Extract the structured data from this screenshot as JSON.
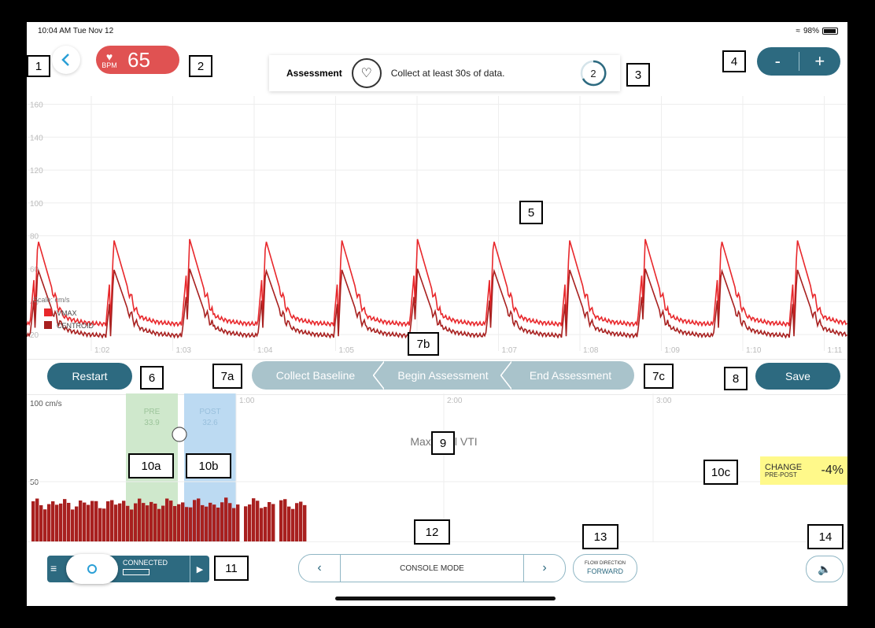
{
  "status": {
    "time": "10:04 AM  Tue Nov 12",
    "battery": "98%"
  },
  "header": {
    "heart_rate": {
      "unit": "BPM",
      "value": "65"
    },
    "assessment": {
      "title": "Assessment",
      "message": "Collect at least 30s of data.",
      "countdown": "2"
    },
    "zoom": {
      "minus": "-",
      "plus": "+"
    }
  },
  "callouts": {
    "c1": "1",
    "c2": "2",
    "c3": "3",
    "c4": "4",
    "c5": "5",
    "c6": "6",
    "c7a": "7a",
    "c7b": "7b",
    "c7c": "7c",
    "c8": "8",
    "c9": "9",
    "c10a": "10a",
    "c10b": "10b",
    "c10c": "10c",
    "c11": "11",
    "c12": "12",
    "c13": "13",
    "c14": "14"
  },
  "workflow": {
    "restart": "Restart",
    "steps": [
      "Collect Baseline",
      "Begin Assessment",
      "End Assessment"
    ],
    "save": "Save"
  },
  "vti": {
    "title": "Max Total VTI",
    "pre": {
      "label": "PRE",
      "value": "33.9"
    },
    "post": {
      "label": "POST",
      "value": "32.6"
    },
    "change_label": "CHANGE",
    "change_sub": "PRE-POST",
    "change_value": "-4%"
  },
  "toolbar": {
    "connection": "CONNECTED",
    "console_mode": "CONSOLE MODE",
    "flow_title": "FLOW DIRECTION",
    "flow_value": "FORWARD"
  },
  "colors": {
    "accent": "#2d6a80",
    "vmax": "#e8272b",
    "centroid": "#a8201f",
    "hr": "#e05252",
    "change_bg": "#fff98a"
  },
  "chart_data": [
    {
      "type": "line",
      "y_ticks": [
        "160",
        "140",
        "120",
        "100",
        "80",
        "60",
        "40",
        "20"
      ],
      "ylim": [
        10,
        165
      ],
      "x_ticks": [
        "1:02",
        "1:03",
        "1:04",
        "1:05",
        "1:06",
        "1:07",
        "1:08",
        "1:09",
        "1:10",
        "1:11"
      ],
      "legend": {
        "scale": "Scale: cm/s",
        "placement": "bottom-left"
      },
      "series": [
        {
          "name": "VMAX",
          "beats": 10,
          "peak": 78,
          "secondary": 48,
          "baseline": 26
        },
        {
          "name": "CENTROID",
          "beats": 10,
          "peak": 60,
          "secondary": 35,
          "baseline": 19
        }
      ]
    },
    {
      "type": "bar",
      "y_ticks": [
        "100 cm/s",
        "50"
      ],
      "ylim": [
        0,
        100
      ],
      "x_ticks": [
        "1:00",
        "2:00",
        "3:00"
      ],
      "bar_count": 70,
      "mean_value": 32
    }
  ]
}
